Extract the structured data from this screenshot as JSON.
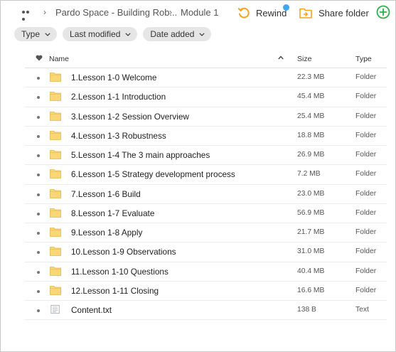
{
  "breadcrumb": {
    "items": [
      "Pardo Space - Building Rob...",
      "Module 1"
    ]
  },
  "toolbar": {
    "rewind_label": "Rewind",
    "share_label": "Share folder"
  },
  "filters": [
    "Type",
    "Last modified",
    "Date added"
  ],
  "table": {
    "headers": {
      "name": "Name",
      "size": "Size",
      "type": "Type"
    },
    "rows": [
      {
        "name": "1.Lesson 1-0 Welcome",
        "size": "22.3 MB",
        "type": "Folder",
        "icon": "folder-icon"
      },
      {
        "name": "2.Lesson 1-1 Introduction",
        "size": "45.4 MB",
        "type": "Folder",
        "icon": "folder-icon"
      },
      {
        "name": "3.Lesson 1-2 Session Overview",
        "size": "25.4 MB",
        "type": "Folder",
        "icon": "folder-icon"
      },
      {
        "name": "4.Lesson 1-3 Robustness",
        "size": "18.8 MB",
        "type": "Folder",
        "icon": "folder-icon"
      },
      {
        "name": "5.Lesson 1-4 The 3 main approaches",
        "size": "26.9 MB",
        "type": "Folder",
        "icon": "folder-icon"
      },
      {
        "name": "6.Lesson 1-5 Strategy development process",
        "size": "7.2 MB",
        "type": "Folder",
        "icon": "folder-icon"
      },
      {
        "name": "7.Lesson 1-6 Build",
        "size": "23.0 MB",
        "type": "Folder",
        "icon": "folder-icon"
      },
      {
        "name": "8.Lesson 1-7 Evaluate",
        "size": "56.9 MB",
        "type": "Folder",
        "icon": "folder-icon"
      },
      {
        "name": "9.Lesson 1-8 Apply",
        "size": "21.7 MB",
        "type": "Folder",
        "icon": "folder-icon"
      },
      {
        "name": "10.Lesson 1-9 Observations",
        "size": "31.0 MB",
        "type": "Folder",
        "icon": "folder-icon"
      },
      {
        "name": "11.Lesson 1-10 Questions",
        "size": "40.4 MB",
        "type": "Folder",
        "icon": "folder-icon"
      },
      {
        "name": "12.Lesson 1-11 Closing",
        "size": "16.6 MB",
        "type": "Folder",
        "icon": "folder-icon"
      },
      {
        "name": "Content.txt",
        "size": "138 B",
        "type": "Text",
        "icon": "text-file-icon"
      }
    ]
  },
  "colors": {
    "accent_orange": "#f4a41d",
    "folder_yellow": "#f8d775",
    "add_green": "#2bb04a",
    "notification_blue": "#3ea8f4"
  }
}
